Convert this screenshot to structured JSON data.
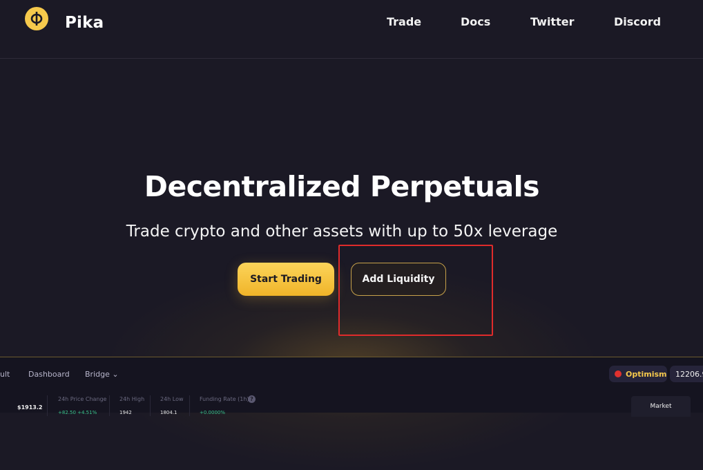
{
  "header": {
    "brand": "Pika",
    "nav": [
      "Trade",
      "Docs",
      "Twitter",
      "Discord"
    ]
  },
  "hero": {
    "title": "Decentralized Perpetuals",
    "subtitle": "Trade crypto and other assets with up to 50x leverage",
    "primary_button": "Start Trading",
    "secondary_button": "Add Liquidity"
  },
  "preview": {
    "nav": [
      "ult",
      "Dashboard",
      "Bridge ⌄"
    ],
    "network": "Optimism",
    "balance": "12206.9",
    "price": "$1913.2",
    "stats": [
      {
        "label": "24h Price Change",
        "value": "+82.50 +4.51%"
      },
      {
        "label": "24h High",
        "value": "1942"
      },
      {
        "label": "24h Low",
        "value": "1804.1"
      },
      {
        "label": "Funding Rate (1h)",
        "value": "+0.0000%"
      }
    ],
    "help": "?",
    "market_tab": "Market"
  },
  "colors": {
    "background": "#1b1925",
    "accent": "#f6c94c",
    "highlight": "#e02b2b"
  },
  "icons": {
    "logo": "pika-logo-icon",
    "network": "optimism-icon",
    "help": "help-icon"
  }
}
